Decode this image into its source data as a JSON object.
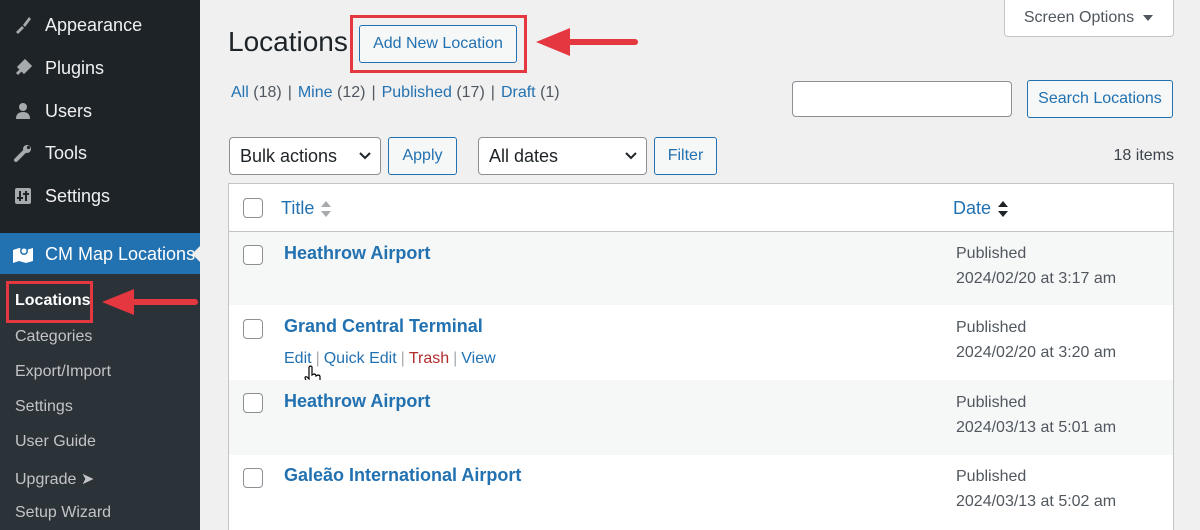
{
  "sidebar": {
    "items": [
      {
        "label": "Appearance",
        "icon": "paintbrush-icon"
      },
      {
        "label": "Plugins",
        "icon": "plugin-icon"
      },
      {
        "label": "Users",
        "icon": "users-icon"
      },
      {
        "label": "Tools",
        "icon": "wrench-icon"
      },
      {
        "label": "Settings",
        "icon": "settings-sliders-icon"
      },
      {
        "label": "CM Map Locations",
        "icon": "map-icon"
      }
    ],
    "submenu": [
      "Locations",
      "Categories",
      "Export/Import",
      "Settings",
      "User Guide",
      "Upgrade ➤",
      "Setup Wizard"
    ]
  },
  "header": {
    "title": "Locations",
    "add_new": "Add New Location",
    "screen_options": "Screen Options"
  },
  "filters": {
    "views": [
      {
        "label": "All",
        "count": "(18)"
      },
      {
        "label": "Mine",
        "count": "(12)"
      },
      {
        "label": "Published",
        "count": "(17)"
      },
      {
        "label": "Draft",
        "count": "(1)"
      }
    ],
    "separator": "|",
    "search_value": "",
    "search_button": "Search Locations",
    "bulk_actions": "Bulk actions",
    "apply": "Apply",
    "dates": "All dates",
    "filter": "Filter",
    "items_count": "18 items"
  },
  "table": {
    "columns": {
      "title": "Title",
      "date": "Date"
    },
    "rows": [
      {
        "title": "Heathrow Airport",
        "status": "Published",
        "date": "2024/02/20 at 3:17 am"
      },
      {
        "title": "Grand Central Terminal",
        "status": "Published",
        "date": "2024/02/20 at 3:20 am"
      },
      {
        "title": "Heathrow Airport",
        "status": "Published",
        "date": "2024/03/13 at 5:01 am"
      },
      {
        "title": "Galeão International Airport",
        "status": "Published",
        "date": "2024/03/13 at 5:02 am"
      }
    ],
    "row_actions": {
      "edit": "Edit",
      "quick_edit": "Quick Edit",
      "trash": "Trash",
      "view": "View",
      "sep": "|"
    }
  },
  "colors": {
    "accent": "#2271b1",
    "highlight": "#e5373f",
    "sidebar": "#1d2327"
  }
}
